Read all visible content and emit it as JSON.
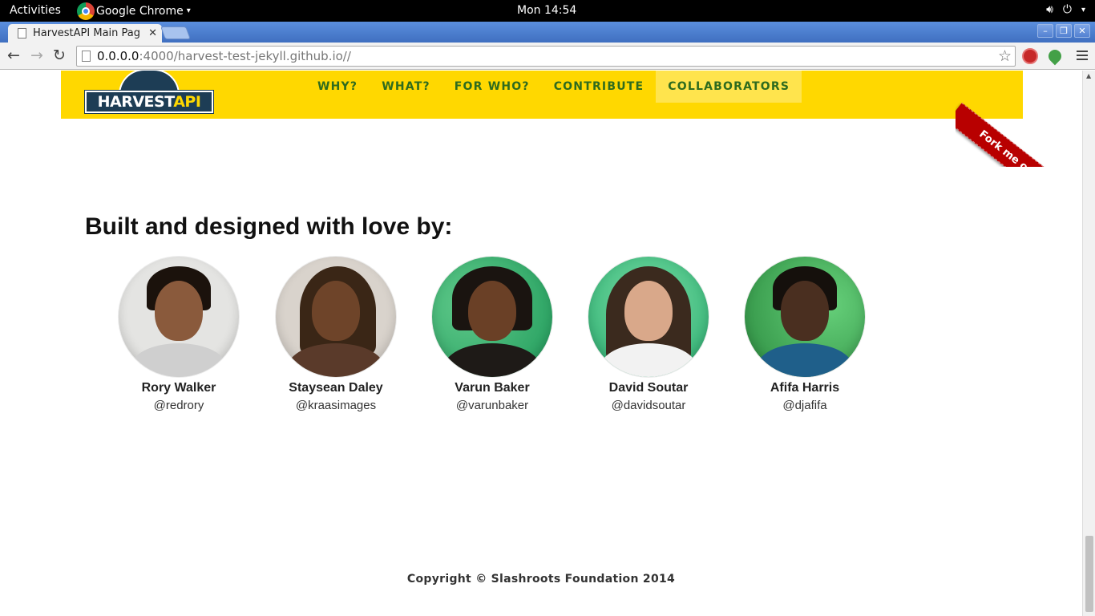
{
  "system": {
    "activities": "Activities",
    "app_name": "Google Chrome",
    "clock": "Mon 14:54"
  },
  "browser": {
    "tab_title": "HarvestAPI Main Pag",
    "url_host": "0.0.0.0",
    "url_path": ":4000/harvest-test-jekyll.github.io//"
  },
  "site": {
    "logo_text": "HARVEST",
    "logo_text_accent": "API",
    "nav": [
      "WHY?",
      "WHAT?",
      "FOR WHO?",
      "CONTRIBUTE",
      "COLLABORATORS"
    ],
    "ribbon": "Fork me on GitHub",
    "heading": "Built and designed with love by:",
    "people": [
      {
        "name": "Rory Walker",
        "handle": "@redrory"
      },
      {
        "name": "Staysean Daley",
        "handle": "@kraasimages"
      },
      {
        "name": "Varun Baker",
        "handle": "@varunbaker"
      },
      {
        "name": "David Soutar",
        "handle": "@davidsoutar"
      },
      {
        "name": "Afifa Harris",
        "handle": "@djafifa"
      }
    ],
    "copyright": "Copyright © Slashroots Foundation 2014"
  },
  "colors": {
    "header_bg": "#ffd800",
    "nav_text": "#2e6b1e",
    "ribbon": "#b80000"
  }
}
